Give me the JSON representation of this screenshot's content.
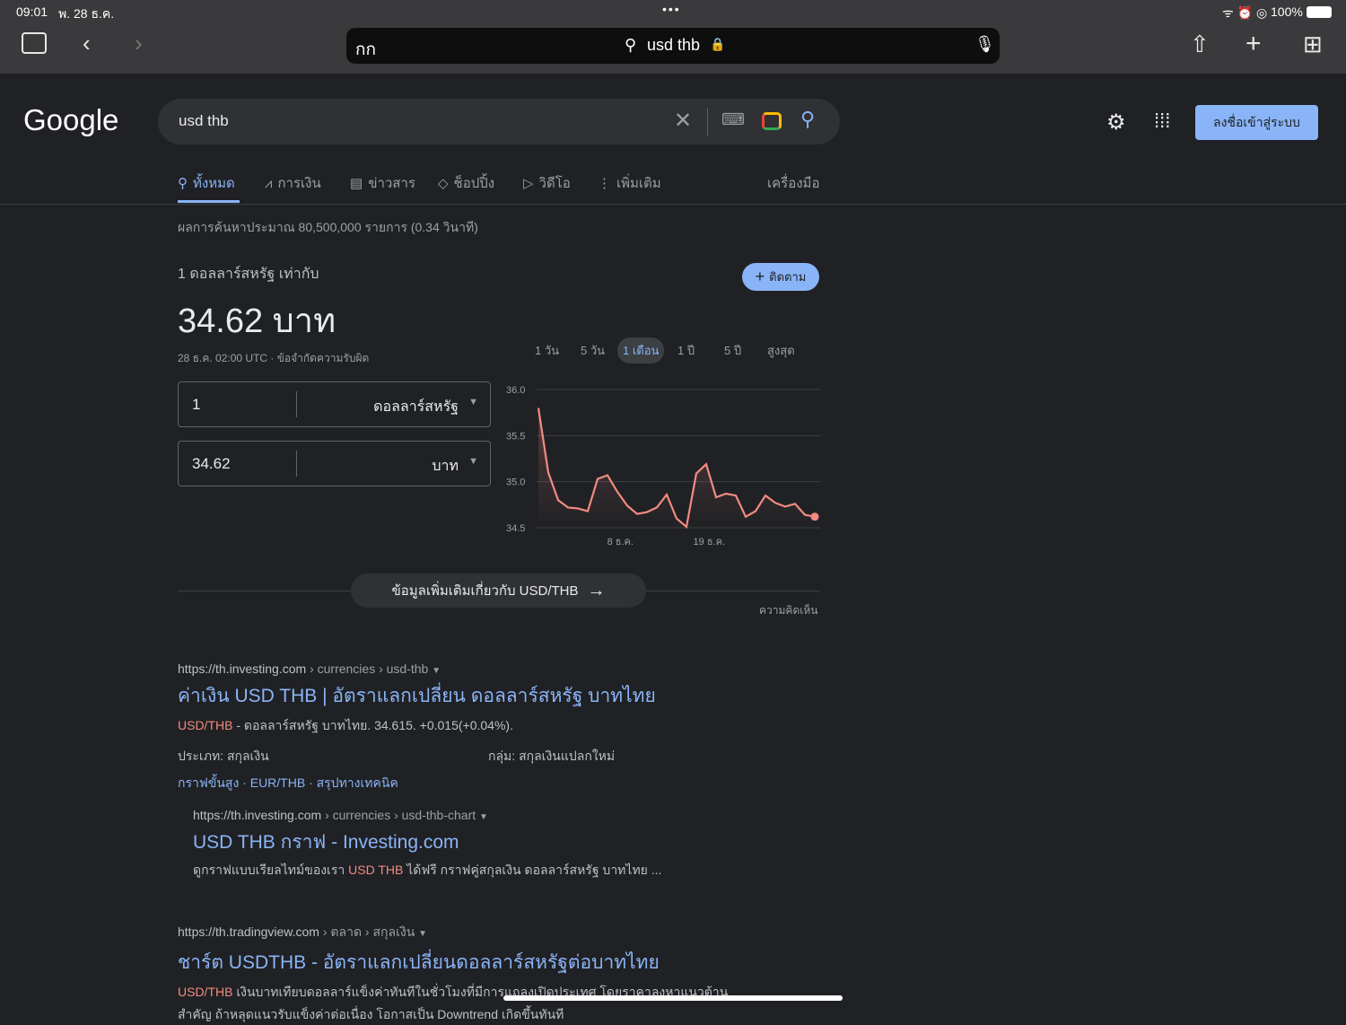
{
  "status": {
    "time": "09:01",
    "date": "พ. 28 ธ.ค.",
    "battery": "100%"
  },
  "browser": {
    "text_size": "กก",
    "url": "usd thb"
  },
  "google": {
    "logo": "Google",
    "query": "usd thb",
    "signin": "ลงชื่อเข้าสู่ระบบ"
  },
  "tabs": [
    {
      "label": "ทั้งหมด"
    },
    {
      "label": "การเงิน"
    },
    {
      "label": "ข่าวสาร"
    },
    {
      "label": "ช็อปปิ้ง"
    },
    {
      "label": "วิดีโอ"
    },
    {
      "label": "เพิ่มเติม"
    }
  ],
  "tools": "เครื่องมือ",
  "result_stats": "ผลการค้นหาประมาณ 80,500,000 รายการ (0.34 วินาที)",
  "fx": {
    "subtitle": "1 ดอลลาร์สหรัฐ เท่ากับ",
    "value": "34.62 บาท",
    "timestamp": "28 ธ.ค. 02:00 UTC · ข้อจำกัดความรับผิด",
    "follow": "ติดตาม",
    "from_amount": "1",
    "from_currency": "ดอลลาร์สหรัฐ",
    "to_amount": "34.62",
    "to_currency": "บาท",
    "ranges": [
      "1 วัน",
      "5 วัน",
      "1 เดือน",
      "1 ปี",
      "5 ปี",
      "สูงสุด"
    ],
    "more": "ข้อมูลเพิ่มเติมเกี่ยวกับ USD/THB",
    "feedback": "ความคิดเห็น"
  },
  "chart_data": {
    "type": "line",
    "title": "USD/THB 1 เดือน",
    "yticks": [
      "36.0",
      "35.5",
      "35.0",
      "34.5"
    ],
    "ylim": [
      34.5,
      36.0
    ],
    "xticks": [
      "8 ธ.ค.",
      "19 ธ.ค."
    ],
    "color": "#f28b82",
    "values": [
      35.8,
      35.1,
      34.8,
      34.72,
      34.71,
      34.68,
      35.03,
      35.07,
      34.89,
      34.74,
      34.65,
      34.67,
      34.72,
      34.86,
      34.6,
      34.51,
      35.09,
      35.19,
      34.83,
      34.87,
      34.85,
      34.62,
      34.68,
      34.85,
      34.77,
      34.73,
      34.76,
      34.64,
      34.62
    ]
  },
  "results": [
    {
      "url": "https://th.investing.com",
      "path": " › currencies › usd-thb",
      "title": "ค่าเงิน USD THB | อัตราแลกเปลี่ยน ดอลลาร์สหรัฐ บาทไทย",
      "hl": "USD/THB",
      "snippet": " - ดอลลาร์สหรัฐ บาทไทย. 34.615. +0.015(+0.04%).",
      "type": "ประเภท: สกุลเงิน",
      "group": "กลุ่ม: สกุลเงินแปลกใหม่",
      "links": "กราฟขั้นสูง · EUR/THB · สรุปทางเทคนิค"
    },
    {
      "url": "https://th.investing.com",
      "path": " › currencies › usd-thb-chart",
      "title": "USD THB กราฟ - Investing.com",
      "pre": "ดูกราฟแบบเรียลไทม์ของเรา ",
      "hl": "USD THB",
      "snippet": " ได้ฟรี กราฟคู่สกุลเงิน ดอลลาร์สหรัฐ บาทไทย ..."
    },
    {
      "url": "https://th.tradingview.com",
      "path": " › ตลาด › สกุลเงิน",
      "title": "ชาร์ต USDTHB - อัตราแลกเปลี่ยนดอลลาร์สหรัฐต่อบาทไทย",
      "hl": "USD/THB",
      "snippet": " เงินบาทเทียบดอลลาร์แข็งค่าทันทีในชั่วโมงที่มีการแถลงเปิดประเทศ โดยราคาลงหาแนวต้าน",
      "line2": "สำคัญ ถ้าหลุดแนวรับแข็งค่าต่อเนื่อง โอกาสเป็น Downtrend เกิดขึ้นทันที"
    }
  ]
}
